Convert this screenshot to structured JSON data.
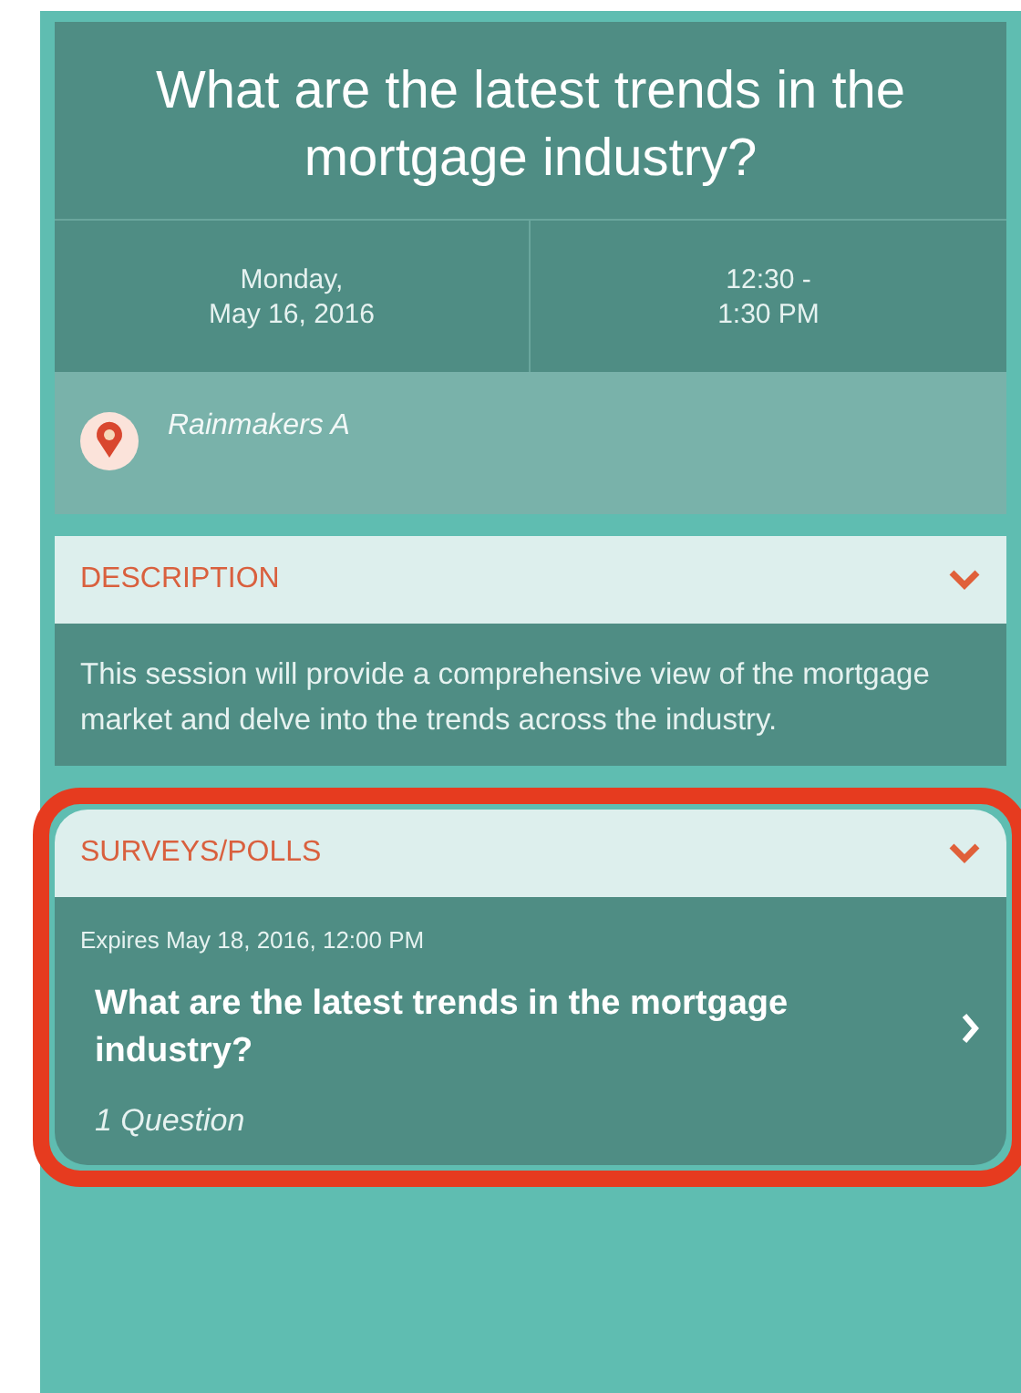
{
  "session": {
    "title": "What are the latest trends in the mortgage industry?",
    "date": "Monday,\nMay 16, 2016",
    "time": "12:30 -\n1:30 PM",
    "location": "Rainmakers A"
  },
  "description": {
    "heading": "DESCRIPTION",
    "expanded": true,
    "text": "This session will provide a comprehensive view of the mortgage market and delve into the trends across the industry."
  },
  "surveys": {
    "heading": "SURVEYS/POLLS",
    "expanded": true,
    "highlighted": true,
    "items": [
      {
        "expires": "Expires May 18, 2016, 12:00 PM",
        "title": "What are the latest trends in the mortgage industry?",
        "count": "1 Question"
      }
    ]
  }
}
